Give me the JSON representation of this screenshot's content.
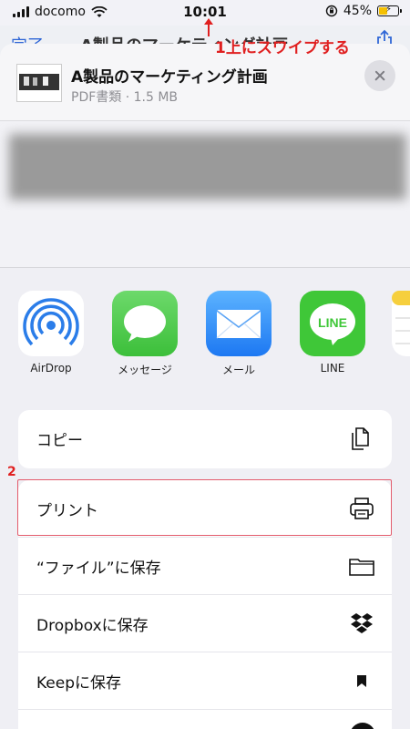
{
  "status": {
    "carrier": "docomo",
    "time": "10:01",
    "battery": "45%",
    "battery_level": 0.45
  },
  "background_page": {
    "done_label": "完了",
    "title": "A製品のマーケティング計画"
  },
  "annotations": {
    "step1": "1上にスワイプする",
    "step2": "2"
  },
  "sheet": {
    "doc_title": "A製品のマーケティング計画",
    "doc_meta": "PDF書類 · 1.5 MB"
  },
  "apps": [
    {
      "label": "AirDrop",
      "icon": "airdrop-icon"
    },
    {
      "label": "メッセージ",
      "icon": "message-bubble-icon"
    },
    {
      "label": "メール",
      "icon": "mail-envelope-icon"
    },
    {
      "label": "LINE",
      "icon": "line-app-icon"
    }
  ],
  "line_icon_text": "LINE",
  "actions": [
    {
      "label": "コピー",
      "icon": "copy-icon"
    },
    {
      "label": "プリント",
      "icon": "printer-icon"
    },
    {
      "label": "“ファイル”に保存",
      "icon": "folder-icon"
    },
    {
      "label": "Dropboxに保存",
      "icon": "dropbox-icon"
    },
    {
      "label": "Keepに保存",
      "icon": "bookmark-icon"
    }
  ],
  "colors": {
    "accent_red": "#e02020",
    "ios_blue": "#2f66d6",
    "highlight_border": "#e35c6c"
  }
}
